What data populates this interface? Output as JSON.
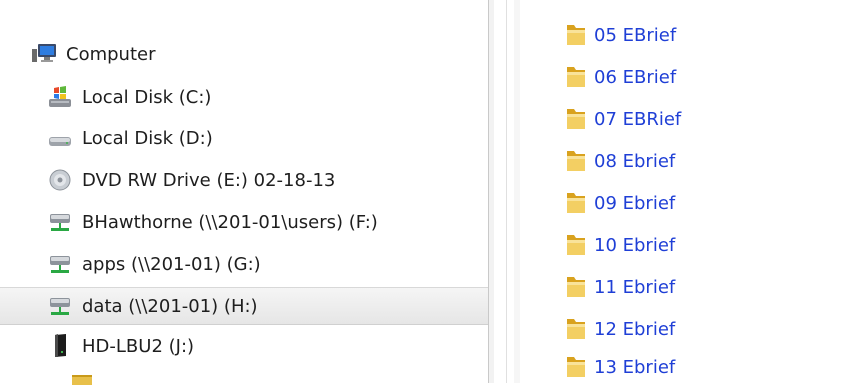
{
  "nav": {
    "items": [
      {
        "label": "Computer",
        "icon": "computer-icon"
      },
      {
        "label": "Local Disk (C:)",
        "icon": "windows-drive-icon"
      },
      {
        "label": "Local Disk (D:)",
        "icon": "hard-drive-icon"
      },
      {
        "label": "DVD RW Drive (E:) 02-18-13",
        "icon": "dvd-icon"
      },
      {
        "label": "BHawthorne (\\\\201-01\\users) (F:)",
        "icon": "network-drive-icon"
      },
      {
        "label": "apps (\\\\201-01) (G:)",
        "icon": "network-drive-icon"
      },
      {
        "label": "data (\\\\201-01) (H:)",
        "icon": "network-drive-icon",
        "selected": true
      },
      {
        "label": "HD-LBU2 (J:)",
        "icon": "external-drive-icon"
      }
    ]
  },
  "content": {
    "folders": [
      {
        "label": "05 EBrief"
      },
      {
        "label": "06 EBrief"
      },
      {
        "label": "07 EBRief"
      },
      {
        "label": "08 Ebrief"
      },
      {
        "label": "09 Ebrief"
      },
      {
        "label": "10 Ebrief"
      },
      {
        "label": "11 Ebrief"
      },
      {
        "label": "12 Ebrief"
      },
      {
        "label": "13 Ebrief"
      }
    ]
  },
  "colors": {
    "folder_text": "#1f3fd6",
    "nav_text": "#1e1e1e",
    "selected_bg": "#e9e9e9"
  }
}
